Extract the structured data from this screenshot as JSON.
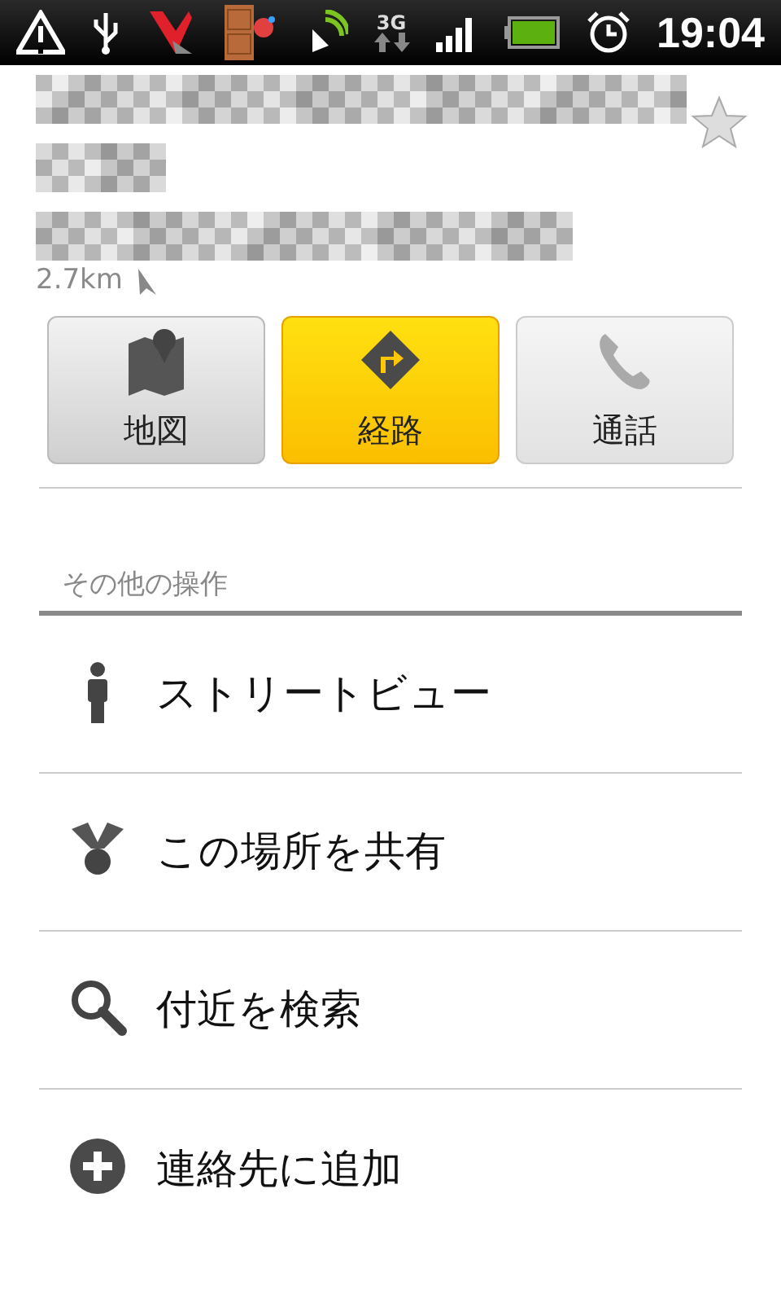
{
  "status_bar": {
    "time": "19:04",
    "network": "3G"
  },
  "place": {
    "starred": false,
    "distance": "2.7km"
  },
  "actions": [
    {
      "label": "地図",
      "kind": "map",
      "selected": false
    },
    {
      "label": "経路",
      "kind": "route",
      "selected": true
    },
    {
      "label": "通話",
      "kind": "phone",
      "selected": false
    }
  ],
  "more": {
    "title": "その他の操作",
    "items": [
      {
        "label": "ストリートビュー",
        "kind": "person"
      },
      {
        "label": "この場所を共有",
        "kind": "share"
      },
      {
        "label": "付近を検索",
        "kind": "search"
      },
      {
        "label": "連絡先に追加",
        "kind": "add"
      }
    ]
  }
}
